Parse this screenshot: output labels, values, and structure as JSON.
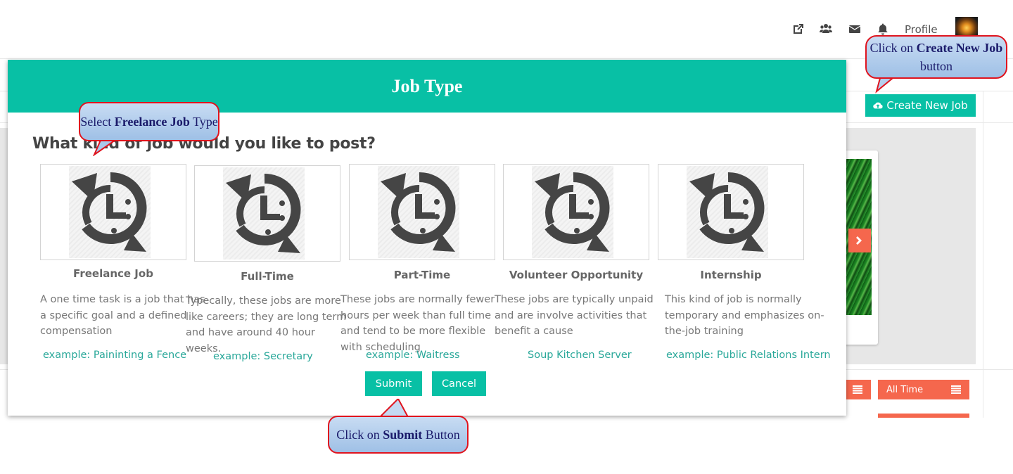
{
  "topbar": {
    "icons": [
      "external-link-icon",
      "users-icon",
      "envelope-icon",
      "bell-icon"
    ],
    "profile_label": "Profile"
  },
  "background": {
    "create_job_label": "Create New Job",
    "filter_label": "All Time"
  },
  "modal": {
    "title": "Job Type",
    "question": "What kind of job would you like to post?",
    "job_types": [
      {
        "title": "Freelance Job",
        "description": "A one time task is a job that has a specific goal and a defined compensation",
        "example": "example: Paininting a Fence"
      },
      {
        "title": "Full-Time",
        "description": "Typecally, these jobs are more like careers; they are long term and have around 40 hour weeks.",
        "example": "example: Secretary"
      },
      {
        "title": "Part-Time",
        "description": "These jobs are normally fewer hours per week than full time and tend to be more flexible with scheduling",
        "example": "example: Waitress"
      },
      {
        "title": "Volunteer Opportunity",
        "description": "These jobs are typically unpaid and are involve activities that benefit a cause",
        "example": "Soup Kitchen Server"
      },
      {
        "title": "Internship",
        "description": "This kind of job is normally temporary and emphasizes on-the-job training",
        "example": "example: Public Relations Intern"
      }
    ],
    "submit_label": "Submit",
    "cancel_label": "Cancel"
  },
  "callouts": {
    "create": {
      "pre": "Click on ",
      "bold": "Create New Job",
      "post": " button"
    },
    "freelance": {
      "pre": "Select ",
      "bold": "Freelance Job",
      "post": " Type"
    },
    "submit": {
      "pre": "Click on ",
      "bold": "Submit",
      "post": " Button"
    }
  },
  "colors": {
    "accent": "#08c0a5",
    "orange": "#f5674d",
    "callout_border": "#e0141e"
  }
}
